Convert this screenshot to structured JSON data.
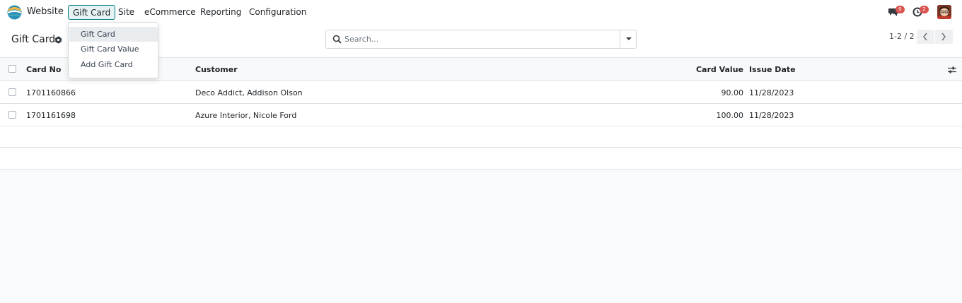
{
  "navbar": {
    "app_name": "Website",
    "menu": [
      "Gift Card",
      "Site",
      "eCommerce",
      "Reporting",
      "Configuration"
    ],
    "messages_count": "0",
    "activities_count": "2"
  },
  "dropdown": {
    "items": [
      "Gift Card",
      "Gift Card Value",
      "Add Gift Card"
    ]
  },
  "control_panel": {
    "title": "Gift Card",
    "search_placeholder": "Search...",
    "pager": "1-2 / 2"
  },
  "table": {
    "columns": [
      "Card No",
      "Customer",
      "Card Value",
      "Issue Date"
    ],
    "rows": [
      {
        "card_no": "1701160866",
        "customer": "Deco Addict, Addison Olson",
        "card_value": "90.00",
        "issue_date": "11/28/2023"
      },
      {
        "card_no": "1701161698",
        "customer": "Azure Interior, Nicole Ford",
        "card_value": "100.00",
        "issue_date": "11/28/2023"
      }
    ]
  },
  "colors": {
    "accent": "#017e84",
    "badge": "#d9534f",
    "background": "#f9fafb"
  },
  "icons": [
    "app-logo-icon",
    "chat-icon",
    "clock-icon",
    "gear-icon",
    "search-icon",
    "caret-down-icon",
    "chevron-left-icon",
    "chevron-right-icon",
    "sliders-icon"
  ]
}
